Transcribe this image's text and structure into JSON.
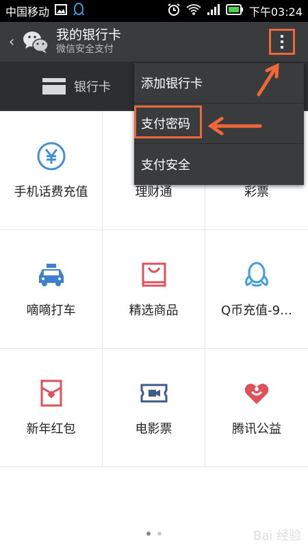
{
  "statusbar": {
    "carrier": "中国移动",
    "time": "下午03:24"
  },
  "header": {
    "title": "我的银行卡",
    "subtitle": "微信安全支付"
  },
  "tab": {
    "label": "银行卡"
  },
  "menu": {
    "items": [
      "添加银行卡",
      "支付密码",
      "支付安全"
    ]
  },
  "grid": {
    "cells": [
      {
        "label": "手机话费充值",
        "icon": "yen-icon",
        "color": "#3e8fd8"
      },
      {
        "label": "理财通",
        "icon": "wallet-icon",
        "color": "#e8a33b"
      },
      {
        "label": "彩票",
        "icon": "lottery-icon",
        "color": "#e0505a"
      },
      {
        "label": "嘀嘀打车",
        "icon": "taxi-icon",
        "color": "#3e7fd0"
      },
      {
        "label": "精选商品",
        "icon": "shopping-bag-icon",
        "color": "#e0505a"
      },
      {
        "label": "Q币充值-9…",
        "icon": "qq-penguin-icon",
        "color": "#3e9ee0"
      },
      {
        "label": "新年红包",
        "icon": "red-envelope-icon",
        "color": "#e0505a"
      },
      {
        "label": "电影票",
        "icon": "movie-ticket-icon",
        "color": "#3c5a8c"
      },
      {
        "label": "腾讯公益",
        "icon": "charity-heart-icon",
        "color": "#e0505a"
      }
    ]
  },
  "colors": {
    "accent": "#f0683a",
    "header_bg": "#3a3b3d",
    "tab_bg": "#2d2e30"
  },
  "watermark": "Bai 经验"
}
